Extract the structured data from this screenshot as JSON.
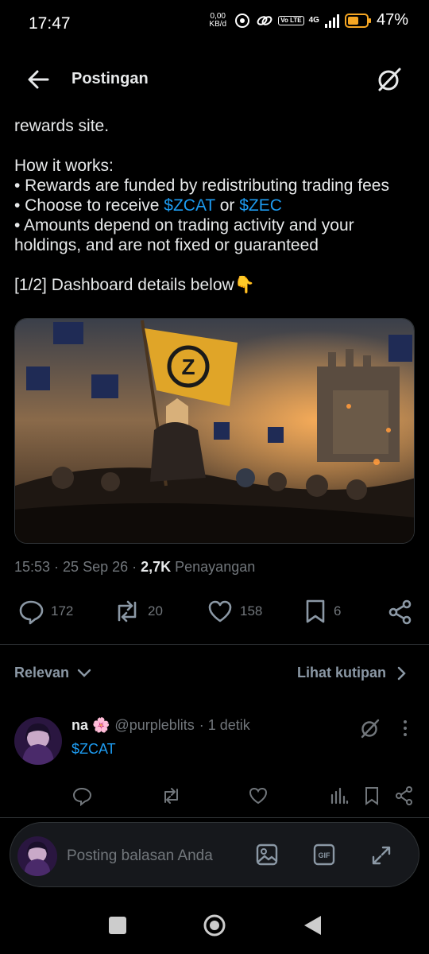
{
  "status": {
    "time": "17:47",
    "net_speed_top": "0,00",
    "net_speed_bottom": "KB/d",
    "volte": "Vo LTE",
    "net": "4G",
    "battery": "47%"
  },
  "header": {
    "title": "Postingan"
  },
  "post": {
    "line1": "rewards site.",
    "line2": "How it works:",
    "line3": "• Rewards are funded by redistributing trading fees",
    "line4_prefix": "• Choose to receive ",
    "line4_link1": "$ZCAT",
    "line4_mid": " or ",
    "line4_link2": "$ZEC",
    "line5": "• Amounts depend on trading activity and your holdings, and are not fixed or guaranteed",
    "line6": "[1/2] Dashboard details below👇",
    "meta_time": "15:53 · 25 Sep 26 · ",
    "meta_views_count": "2,7K",
    "meta_views_label": " Penayangan"
  },
  "actions": {
    "replies": "172",
    "reposts": "20",
    "likes": "158",
    "bookmarks": "6"
  },
  "sort": {
    "label": "Relevan",
    "quotes": "Lihat kutipan"
  },
  "reply": {
    "name": "na 🌸",
    "handle": "@purpleblits",
    "time": "· 1 detik",
    "text": "$ZCAT"
  },
  "compose": {
    "placeholder": "Posting balasan Anda"
  },
  "colors": {
    "link": "#1d9bf0",
    "muted": "#71767b",
    "text": "#e7e9ea",
    "flag": "#e0a528"
  }
}
